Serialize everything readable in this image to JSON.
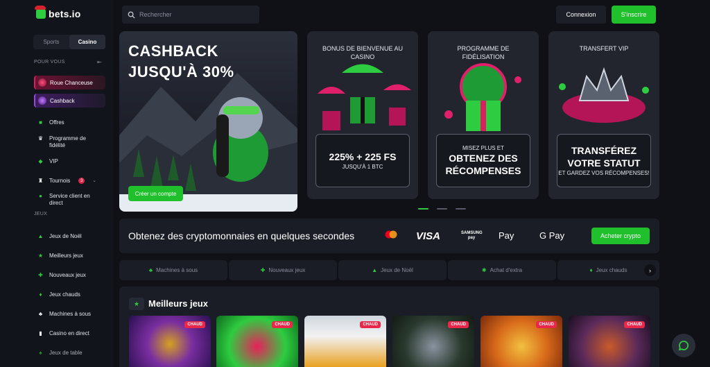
{
  "brand": {
    "name": "bets.io"
  },
  "sidebar": {
    "toggle": [
      "Sports",
      "Casino"
    ],
    "for_you_label": "POUR VOUS",
    "promos": [
      "Roue Chanceuse",
      "Cashback"
    ],
    "items": [
      {
        "label": "Offres",
        "icon": "gift-icon"
      },
      {
        "label": "Programme de fidélité",
        "icon": "crown-icon"
      },
      {
        "label": "VIP",
        "icon": "diamond-icon"
      },
      {
        "label": "Tournois",
        "icon": "trophy-icon",
        "badge": "3"
      },
      {
        "label": "Service client en direct",
        "icon": "headset-icon"
      }
    ],
    "games_label": "JEUX",
    "game_items": [
      {
        "label": "Jeux de Noël",
        "icon": "tree-icon"
      },
      {
        "label": "Meilleurs jeux",
        "icon": "star-icon"
      },
      {
        "label": "Nouveaux jeux",
        "icon": "new-icon"
      },
      {
        "label": "Jeux chauds",
        "icon": "fire-icon"
      },
      {
        "label": "Machines à sous",
        "icon": "slot-icon"
      },
      {
        "label": "Casino en direct",
        "icon": "live-icon"
      },
      {
        "label": "Jeux de table",
        "icon": "cards-icon"
      }
    ]
  },
  "header": {
    "search_placeholder": "Rechercher",
    "login": "Connexion",
    "signup": "S'inscrire"
  },
  "hero": {
    "title_line1": "CASHBACK",
    "title_line2": "JUSQU'À 30%",
    "cta": "Créer un compte"
  },
  "cards": [
    {
      "title": "BONUS DE BIENVENUE AU CASINO",
      "big": "225% + 225 FS",
      "small": "JUSQU'À 1 BTC"
    },
    {
      "title": "PROGRAMME DE FIDÉLISATION",
      "small": "MISEZ PLUS ET",
      "big": "OBTENEZ DES RÉCOMPENSES"
    },
    {
      "title": "TRANSFERT VIP",
      "big": "TRANSFÉREZ VOTRE STATUT",
      "small": "ET GARDEZ VOS RÉCOMPENSES!"
    }
  ],
  "crypto": {
    "text": "Obtenez des cryptomonnaies en quelques secondes",
    "mastercard": "mastercard",
    "visa": "VISA",
    "samsung": "SAMSUNG pay",
    "apple": " Pay",
    "google": "G Pay",
    "cta": "Acheter crypto"
  },
  "categories": [
    "Machines à sous",
    "Nouveaux jeux",
    "Jeux de Noël",
    "Achat d'extra",
    "Jeux chauds"
  ],
  "best": {
    "title": "Meilleurs jeux",
    "hot_label": "CHAUD"
  },
  "colors": {
    "accent": "#20c02c",
    "hot": "#e8274b",
    "bg": "#0f1116"
  }
}
